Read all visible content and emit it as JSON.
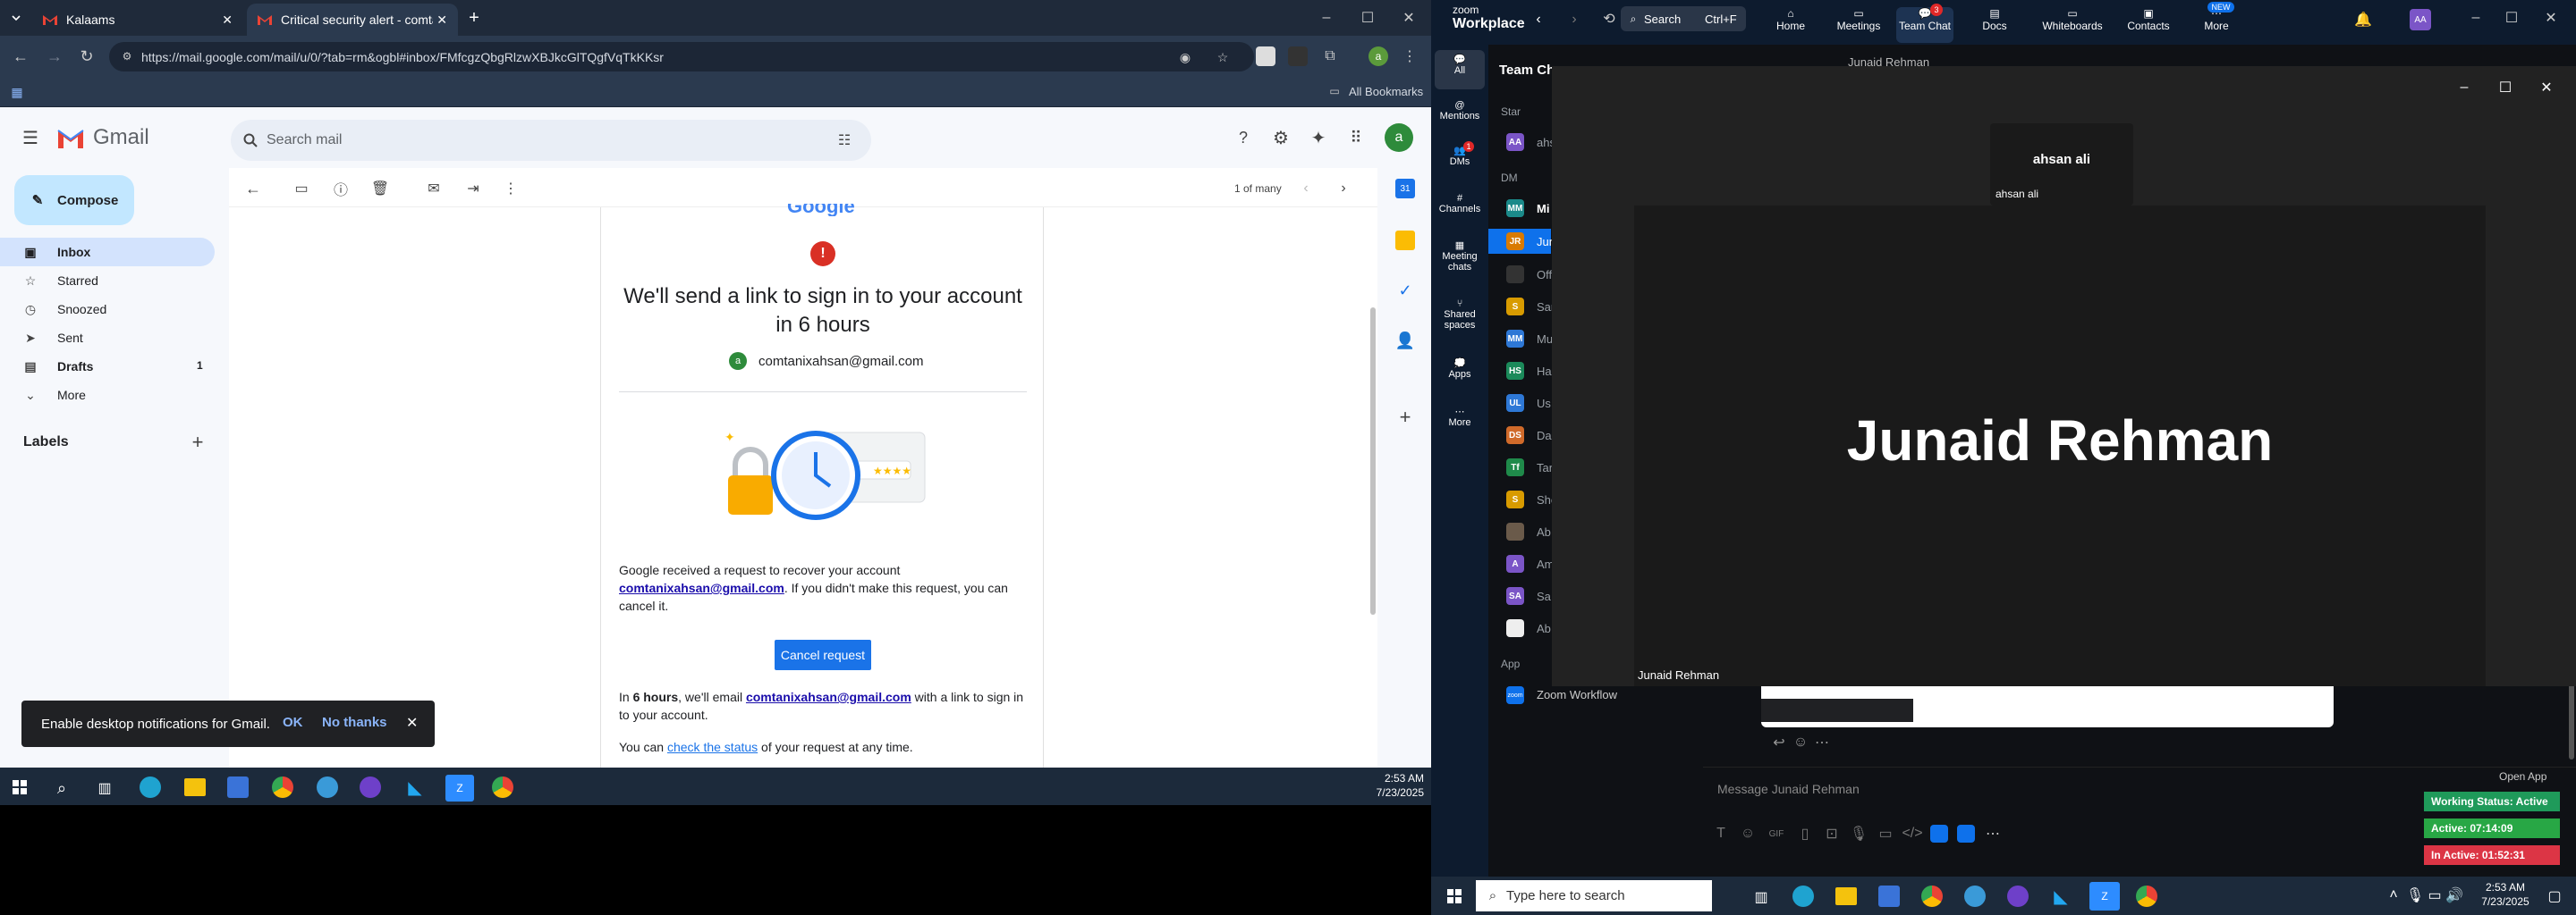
{
  "browser": {
    "tabs": [
      {
        "title": "Kalaams"
      },
      {
        "title": "Critical security alert - comtanic"
      }
    ],
    "url": "https://mail.google.com/mail/u/0/?tab=rm&ogbl#inbox/FMfcgzQbgRlzwXBJkcGlTQgfVqTkKKsr",
    "all_bookmarks": "All Bookmarks"
  },
  "gmail": {
    "logo_text": "Gmail",
    "search_placeholder": "Search mail",
    "compose": "Compose",
    "nav": [
      {
        "label": "Inbox",
        "count": ""
      },
      {
        "label": "Starred",
        "count": ""
      },
      {
        "label": "Snoozed",
        "count": ""
      },
      {
        "label": "Sent",
        "count": ""
      },
      {
        "label": "Drafts",
        "count": "1"
      },
      {
        "label": "More",
        "count": ""
      }
    ],
    "labels_heading": "Labels",
    "pager": "1 of many",
    "avatar_letter": "a",
    "email": {
      "heading": "We'll send a link to sign in to your account in 6 hours",
      "account": "comtanixahsan@gmail.com",
      "body1_pre": "Google received a request to recover your account ",
      "body1_link": "comtanixahsan@gmail.com",
      "body1_post": ". If you didn't make this request, you can cancel it.",
      "cancel_button": "Cancel request",
      "body2_pre": "In ",
      "body2_bold": "6 hours",
      "body2_mid": ", we'll email ",
      "body2_link": "comtanixahsan@gmail.com",
      "body2_post": " with a link to sign in to your account.",
      "body3_pre": "You can ",
      "body3_link": "check the status",
      "body3_post": " of your request at any time."
    },
    "notification": {
      "text": "Enable desktop notifications for Gmail.",
      "ok": "OK",
      "no_thanks": "No thanks"
    }
  },
  "taskbar_left": {
    "time": "2:53 AM",
    "date": "7/23/2025"
  },
  "zoom": {
    "brand_top": "zoom",
    "brand_bottom": "Workplace",
    "search_label": "Search",
    "search_shortcut": "Ctrl+F",
    "nav": [
      {
        "label": "Home"
      },
      {
        "label": "Meetings"
      },
      {
        "label": "Team Chat",
        "badge": "3"
      },
      {
        "label": "Docs"
      },
      {
        "label": "Whiteboards"
      },
      {
        "label": "Contacts"
      },
      {
        "label": "More",
        "badge": "NEW"
      }
    ],
    "sidebar": [
      {
        "label": "All"
      },
      {
        "label": "Mentions"
      },
      {
        "label": "DMs",
        "badge": "1"
      },
      {
        "label": "Channels"
      },
      {
        "label": "Meeting chats"
      },
      {
        "label": "Shared spaces"
      },
      {
        "label": "Apps"
      },
      {
        "label": "More"
      }
    ],
    "chat_panel_title": "Team Ch",
    "header_contact": "Junaid Rehman",
    "section_starred": "Star",
    "section_dms": "DM",
    "section_apps": "App",
    "contacts": [
      {
        "initials": "AA",
        "name": "ahs",
        "color": "#7b55c7"
      },
      {
        "initials": "MM",
        "name": "Mi",
        "color": "#1b8a8a"
      },
      {
        "initials": "JR",
        "name": "Jun",
        "color": "#d97a00"
      },
      {
        "initials": "",
        "name": "Off",
        "color": "#333"
      },
      {
        "initials": "S",
        "name": "Sar",
        "color": "#d89b00"
      },
      {
        "initials": "MM",
        "name": "Mu",
        "color": "#2e78d6"
      },
      {
        "initials": "HS",
        "name": "Ha",
        "color": "#1b8a5a"
      },
      {
        "initials": "UL",
        "name": "Us",
        "color": "#2e78d6"
      },
      {
        "initials": "DS",
        "name": "Da",
        "color": "#d06a2a"
      },
      {
        "initials": "Tf",
        "name": "Tar",
        "color": "#1f8a4a"
      },
      {
        "initials": "S",
        "name": "She",
        "color": "#d89b00"
      },
      {
        "initials": "",
        "name": "Ab",
        "color": "#6a5a4a"
      },
      {
        "initials": "A",
        "name": "Am",
        "color": "#7b55c7"
      },
      {
        "initials": "SA",
        "name": "Sa",
        "color": "#7b55c7"
      },
      {
        "initials": "",
        "name": "Ab",
        "color": "#eee"
      }
    ],
    "zoom_workflow": "Zoom Workflow",
    "meeting": {
      "self_tile_name": "ahsan ali",
      "self_tile_label": "ahsan ali",
      "main_name": "Junaid Rehman",
      "main_label": "Junaid Rehman"
    },
    "message_placeholder": "Message Junaid Rehman",
    "open_app": "Open App",
    "status": {
      "working": "Working Status: Active",
      "active": "Active: 07:14:09",
      "inactive": "In Active: 01:52:31"
    },
    "colors": {
      "working": "#1f9a5a",
      "active": "#28a745",
      "inactive": "#dc3545"
    }
  },
  "taskbar_right": {
    "search_placeholder": "Type here to search",
    "time": "2:53 AM",
    "date": "7/23/2025"
  }
}
